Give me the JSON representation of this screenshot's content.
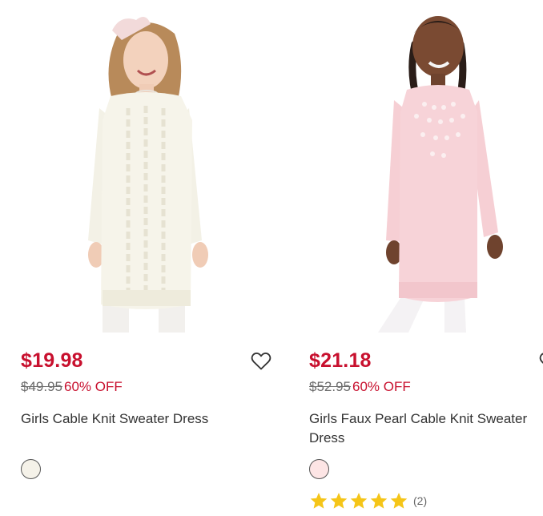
{
  "products": [
    {
      "name": "Girls Cable Knit Sweater Dress",
      "sale_price": "$19.98",
      "original_price": "$49.95",
      "discount": "60% OFF",
      "swatch_color": "#f5f2e9",
      "photo_alt": "Girl wearing cream cable knit sweater dress"
    },
    {
      "name": "Girls Faux Pearl Cable Knit Sweater Dress",
      "sale_price": "$21.18",
      "original_price": "$52.95",
      "discount": "60% OFF",
      "swatch_color": "#fde5e5",
      "photo_alt": "Girl wearing pink faux pearl cable knit sweater dress",
      "rating": {
        "stars": 5,
        "count": "(2)"
      }
    }
  ],
  "icons": {
    "wishlist": "heart-outline-icon",
    "star": "star-icon"
  },
  "colors": {
    "sale_price": "#c8102e",
    "original_price": "#6b6b6b",
    "star": "#f5c518"
  }
}
